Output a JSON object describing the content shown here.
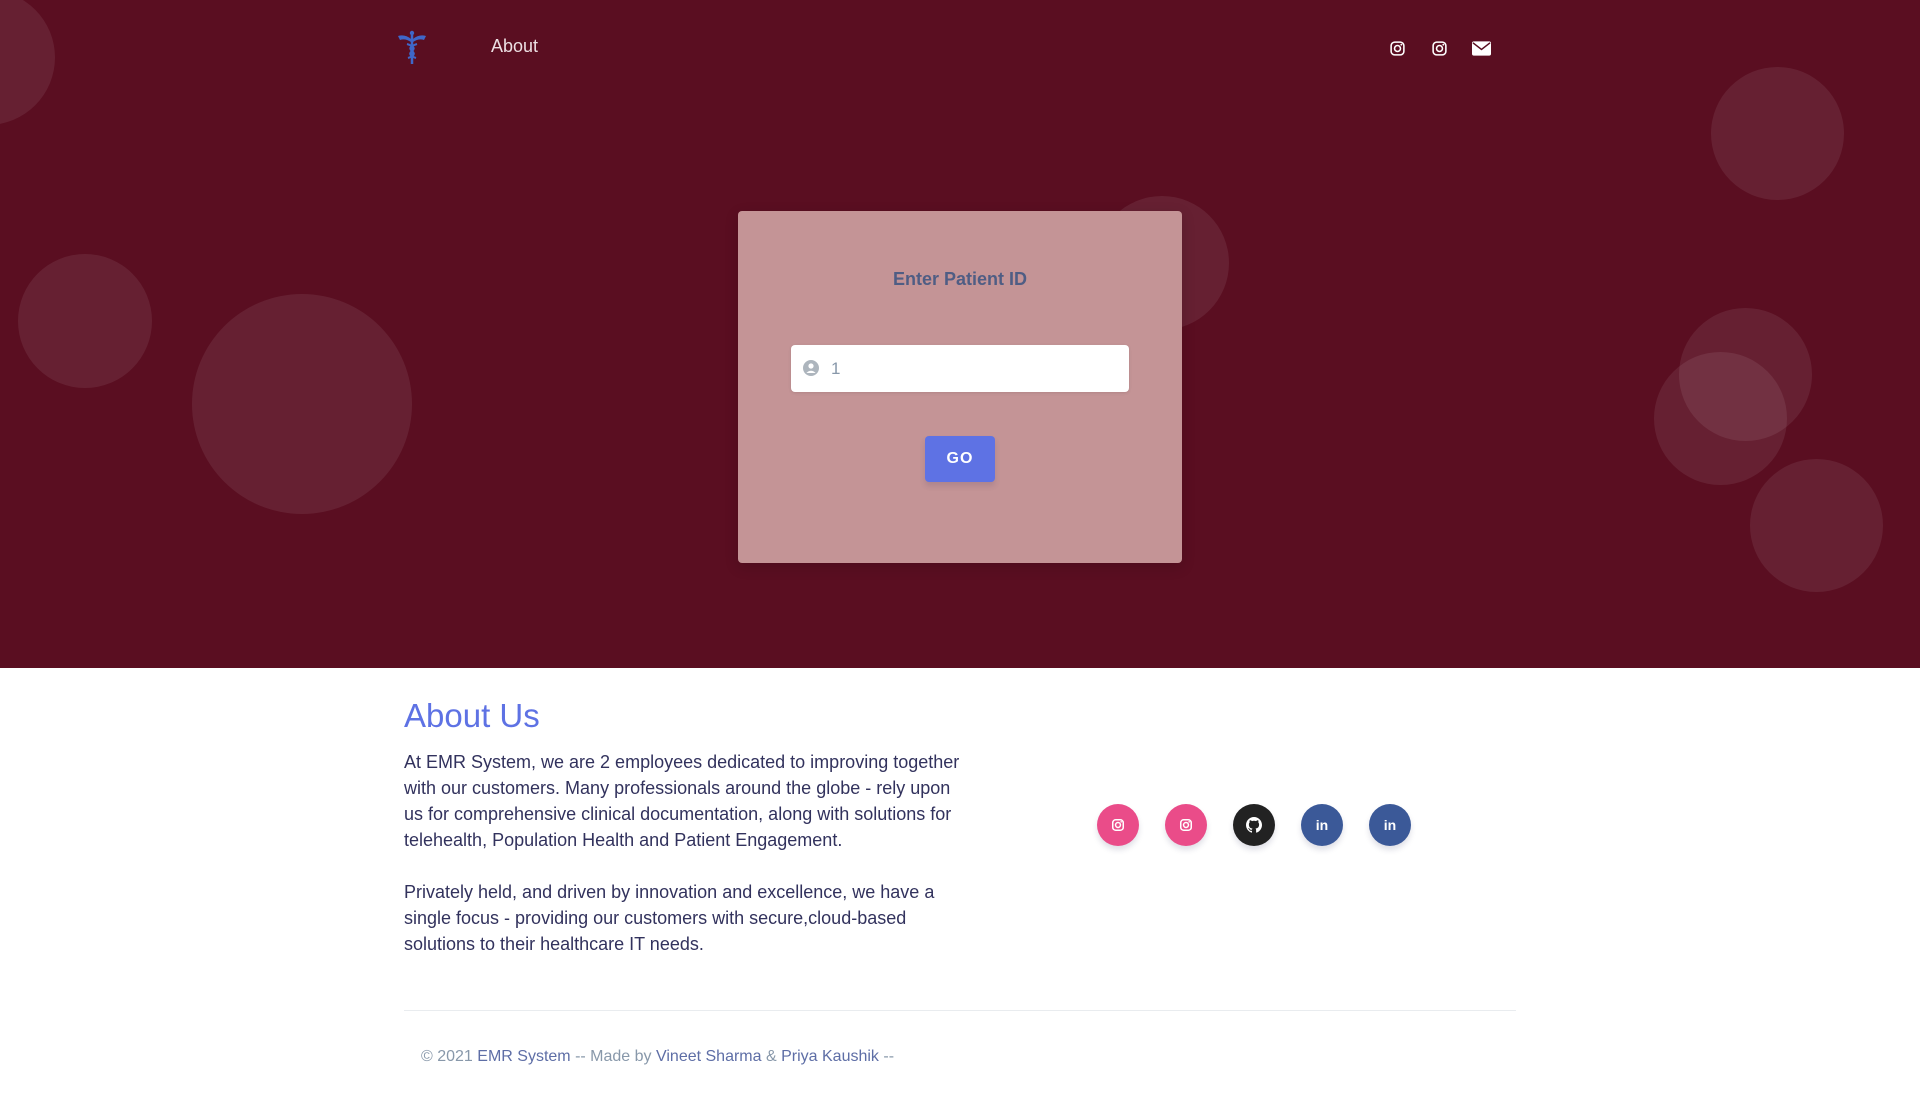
{
  "nav": {
    "logo_icon": "caduceus-icon",
    "about_label": "About",
    "icons": [
      "instagram-icon",
      "instagram-icon",
      "envelope-icon"
    ]
  },
  "form": {
    "title": "Enter Patient ID",
    "input_value": "1",
    "input_icon": "user-circle-icon",
    "go_label": "GO"
  },
  "about": {
    "title": "About Us",
    "paragraph1": "At EMR System, we are 2 employees dedicated to improving together with our customers. Many professionals around the globe - rely upon us for comprehensive clinical documentation, along with solutions for telehealth, Population Health and Patient Engagement.",
    "paragraph2": "Privately held, and driven by innovation and excellence, we have a single focus - providing our customers with secure,cloud-based solutions to their healthcare IT needs."
  },
  "socials": [
    {
      "icon": "instagram-icon",
      "color": "#ea4c89"
    },
    {
      "icon": "instagram-icon",
      "color": "#ea4c89"
    },
    {
      "icon": "github-icon",
      "color": "#222222"
    },
    {
      "icon": "linkedin-icon",
      "color": "#3b5998"
    },
    {
      "icon": "linkedin-icon",
      "color": "#3b5998"
    }
  ],
  "footer": {
    "prefix": "© 2021 ",
    "brand": "EMR System",
    "middle": " -- Made by ",
    "author1": "Vineet Sharma",
    "amp": " & ",
    "author2": "Priya Kaushik",
    "suffix": " --"
  },
  "colors": {
    "hero_background": "#5a0e21",
    "card_background": "#c49496",
    "primary": "#5e72e4"
  }
}
